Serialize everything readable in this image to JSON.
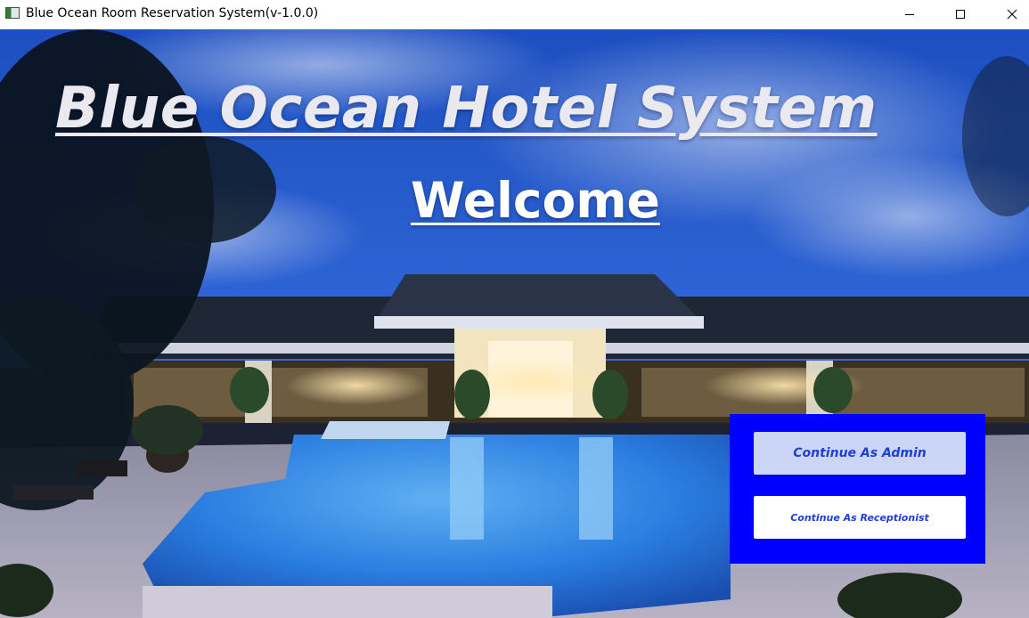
{
  "window": {
    "title": "Blue Ocean Room Reservation System(v-1.0.0)",
    "icons": [
      "app-icon",
      "minimize-icon",
      "maximize-icon",
      "close-icon"
    ]
  },
  "hero": {
    "title": "Blue Ocean Hotel System",
    "subtitle": "Welcome"
  },
  "login_panel": {
    "admin_label": "Continue As Admin",
    "receptionist_label": "Continue As Receptionist"
  },
  "colors": {
    "panel": "#0000ff",
    "button_text": "#1f3fd1",
    "admin_button_bg": "#cbd5f5",
    "receptionist_button_bg": "#ffffff",
    "title_text": "#e9e9ef"
  }
}
